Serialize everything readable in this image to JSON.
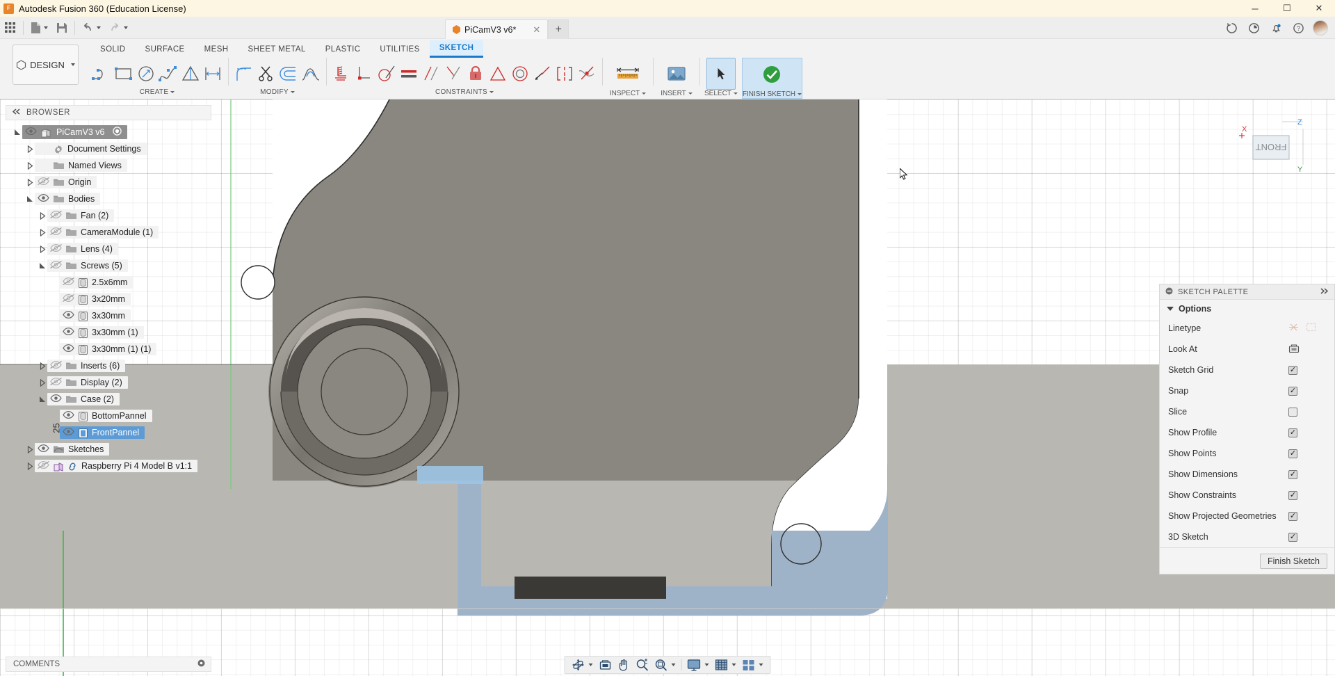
{
  "window": {
    "title": "Autodesk Fusion 360 (Education License)",
    "app_icon": "fusion-logo-icon",
    "minimize": "─",
    "maximize": "☐",
    "close": "✕"
  },
  "quick_access": {
    "items": [
      {
        "name": "app-grid-icon",
        "label": ""
      },
      {
        "name": "new-document-icon",
        "label": ""
      },
      {
        "name": "save-icon",
        "label": ""
      },
      {
        "name": "undo-icon",
        "label": ""
      },
      {
        "name": "redo-icon",
        "label": ""
      }
    ]
  },
  "document_tab": {
    "title": "PiCamV3 v6*",
    "close_label": "✕",
    "new_tab_label": "+"
  },
  "top_right_icons": [
    {
      "name": "job-status-icon",
      "glyph": "⟳"
    },
    {
      "name": "recent-updates-icon",
      "glyph": "◔"
    },
    {
      "name": "notifications-icon",
      "glyph": "ὑ4"
    },
    {
      "name": "help-icon",
      "glyph": "?"
    },
    {
      "name": "user-avatar",
      "glyph": ""
    }
  ],
  "ribbon": {
    "workspace_button": "DESIGN",
    "tabs": [
      {
        "label": "SOLID",
        "active": false
      },
      {
        "label": "SURFACE",
        "active": false
      },
      {
        "label": "MESH",
        "active": false
      },
      {
        "label": "SHEET METAL",
        "active": false
      },
      {
        "label": "PLASTIC",
        "active": false
      },
      {
        "label": "UTILITIES",
        "active": false
      },
      {
        "label": "SKETCH",
        "active": true
      }
    ],
    "groups": [
      {
        "label": "CREATE",
        "has_caret": true
      },
      {
        "label": "MODIFY",
        "has_caret": true
      },
      {
        "label": "CONSTRAINTS",
        "has_caret": true
      },
      {
        "label": "INSPECT",
        "has_caret": true
      },
      {
        "label": "INSERT",
        "has_caret": true
      },
      {
        "label": "SELECT",
        "has_caret": true
      },
      {
        "label": "FINISH SKETCH",
        "has_caret": true
      }
    ],
    "create_tools": [
      "line-icon",
      "rectangle-icon",
      "circle-icon",
      "spline-icon",
      "polygon-icon",
      "dimension-icon"
    ],
    "modify_tools": [
      "fillet-icon",
      "trim-icon",
      "offset-icon",
      "curvature-icon"
    ],
    "constraint_tools": [
      "ground-icon",
      "coincident-icon",
      "tangent-icon",
      "equal-icon",
      "parallel-icon",
      "perpendicular-icon",
      "fix-lock-icon",
      "midpoint-icon",
      "concentric-icon",
      "collinear-icon",
      "symmetry-icon",
      "curvature-constraint-icon"
    ],
    "inspect_icon": "measure-ruler-icon",
    "insert_icon": "insert-image-icon",
    "select_icon": "select-cursor-icon",
    "finish_icon": "finish-check-icon"
  },
  "browser": {
    "header": "BROWSER",
    "collapse_icon": "collapse-left-icon",
    "tree": [
      {
        "label": "PiCamV3 v6",
        "indent": 0,
        "arrow": "expanded",
        "eye": "visible",
        "icon": "component-icon",
        "state": "root",
        "extra": "radio-icon"
      },
      {
        "label": "Document Settings",
        "indent": 1,
        "arrow": "collapsed",
        "eye": "none",
        "icon": "gear-icon",
        "state": "normal"
      },
      {
        "label": "Named Views",
        "indent": 1,
        "arrow": "collapsed",
        "eye": "none",
        "icon": "folder-icon",
        "state": "normal"
      },
      {
        "label": "Origin",
        "indent": 1,
        "arrow": "collapsed",
        "eye": "hidden",
        "icon": "folder-icon",
        "state": "normal"
      },
      {
        "label": "Bodies",
        "indent": 1,
        "arrow": "expanded",
        "eye": "visible",
        "icon": "folder-icon",
        "state": "normal"
      },
      {
        "label": "Fan (2)",
        "indent": 2,
        "arrow": "collapsed",
        "eye": "hidden",
        "icon": "folder-icon",
        "state": "normal"
      },
      {
        "label": "CameraModule (1)",
        "indent": 2,
        "arrow": "collapsed",
        "eye": "hidden",
        "icon": "folder-icon",
        "state": "normal"
      },
      {
        "label": "Lens (4)",
        "indent": 2,
        "arrow": "collapsed",
        "eye": "hidden",
        "icon": "folder-icon",
        "state": "normal"
      },
      {
        "label": "Screws (5)",
        "indent": 2,
        "arrow": "expanded",
        "eye": "hidden",
        "icon": "folder-icon",
        "state": "normal"
      },
      {
        "label": "2.5x6mm",
        "indent": 3,
        "arrow": "none",
        "eye": "hidden",
        "icon": "body-icon",
        "state": "normal"
      },
      {
        "label": "3x20mm",
        "indent": 3,
        "arrow": "none",
        "eye": "hidden",
        "icon": "body-icon",
        "state": "normal"
      },
      {
        "label": "3x30mm",
        "indent": 3,
        "arrow": "none",
        "eye": "visible",
        "icon": "body-icon",
        "state": "normal"
      },
      {
        "label": "3x30mm (1)",
        "indent": 3,
        "arrow": "none",
        "eye": "visible",
        "icon": "body-icon",
        "state": "normal"
      },
      {
        "label": "3x30mm (1) (1)",
        "indent": 3,
        "arrow": "none",
        "eye": "visible",
        "icon": "body-icon",
        "state": "normal"
      },
      {
        "label": "Inserts (6)",
        "indent": 2,
        "arrow": "collapsed",
        "eye": "hidden",
        "icon": "folder-icon",
        "state": "normal"
      },
      {
        "label": "Display (2)",
        "indent": 2,
        "arrow": "collapsed",
        "eye": "hidden",
        "icon": "folder-icon",
        "state": "normal"
      },
      {
        "label": "Case (2)",
        "indent": 2,
        "arrow": "expanded",
        "eye": "visible",
        "icon": "folder-icon",
        "state": "normal"
      },
      {
        "label": "BottomPannel",
        "indent": 3,
        "arrow": "none",
        "eye": "visible",
        "icon": "body-icon",
        "state": "normal"
      },
      {
        "label": "FrontPannel",
        "indent": 3,
        "arrow": "none",
        "eye": "visible",
        "icon": "body-icon-blue",
        "state": "selected"
      },
      {
        "label": "Sketches",
        "indent": 1,
        "arrow": "collapsed",
        "eye": "visible",
        "icon": "sketch-folder-icon",
        "state": "normal"
      },
      {
        "label": "Raspberry Pi 4 Model B v1:1",
        "indent": 1,
        "arrow": "collapsed",
        "eye": "hidden",
        "icon": "linked-component-icon",
        "state": "normal"
      }
    ]
  },
  "sketch_palette": {
    "header": "SKETCH PALETTE",
    "header_icon": "minus-circle-icon",
    "expand_icon": "expand-right-icon",
    "section": "Options",
    "rows": [
      {
        "label": "Linetype",
        "control": "icons",
        "icons": [
          "construction-line-icon",
          "centerline-icon"
        ]
      },
      {
        "label": "Look At",
        "control": "button",
        "icons": [
          "look-at-icon"
        ]
      },
      {
        "label": "Sketch Grid",
        "control": "checkbox",
        "checked": true
      },
      {
        "label": "Snap",
        "control": "checkbox",
        "checked": true
      },
      {
        "label": "Slice",
        "control": "checkbox",
        "checked": false
      },
      {
        "label": "Show Profile",
        "control": "checkbox",
        "checked": true
      },
      {
        "label": "Show Points",
        "control": "checkbox",
        "checked": true
      },
      {
        "label": "Show Dimensions",
        "control": "checkbox",
        "checked": true
      },
      {
        "label": "Show Constraints",
        "control": "checkbox",
        "checked": true
      },
      {
        "label": "Show Projected Geometries",
        "control": "checkbox",
        "checked": true
      },
      {
        "label": "3D Sketch",
        "control": "checkbox",
        "checked": true
      }
    ],
    "finish_button": "Finish Sketch",
    "check_glyph": "✓"
  },
  "viewcube": {
    "face": "FRONT",
    "axis_x": "X",
    "axis_y": "Y",
    "axis_z": "Z"
  },
  "canvas": {
    "dimension_label": "25"
  },
  "comments": {
    "label": "COMMENTS",
    "expand_icon": "circle-dot-icon"
  },
  "nav_bar": {
    "items": [
      {
        "name": "orbit-icon",
        "caret": true
      },
      {
        "name": "look-at-icon",
        "caret": false
      },
      {
        "name": "pan-hand-icon",
        "caret": false
      },
      {
        "name": "zoom-icon",
        "caret": false
      },
      {
        "name": "fit-icon",
        "caret": true
      },
      {
        "name": "display-settings-icon",
        "caret": true
      },
      {
        "name": "grid-snap-icon",
        "caret": true
      },
      {
        "name": "viewports-icon",
        "caret": true
      }
    ]
  },
  "colors": {
    "accent": "#1a79c8",
    "tab_active_bg": "#ddeffc",
    "selection": "#5c9bd6",
    "titlebar_bg": "#fdf6e3",
    "finish_green": "#2e9e3e",
    "model_body": "#8a8780",
    "model_blue": "#9fb3c8"
  }
}
